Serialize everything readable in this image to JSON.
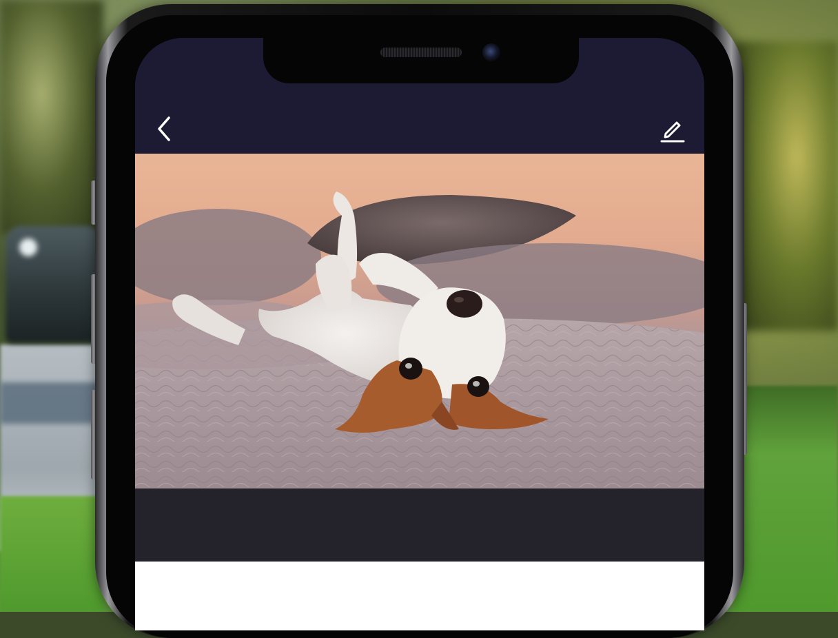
{
  "app": {
    "header": {
      "back_icon": "chevron-left-icon",
      "edit_icon": "pencil-icon",
      "background": "#1d1b33",
      "icon_color": "#ffffff"
    },
    "photo": {
      "subject": "jack-russell-puppy-lying-upside-down-on-bed"
    },
    "colors": {
      "dark_band": "#24232c",
      "content_bg": "#ffffff"
    }
  }
}
